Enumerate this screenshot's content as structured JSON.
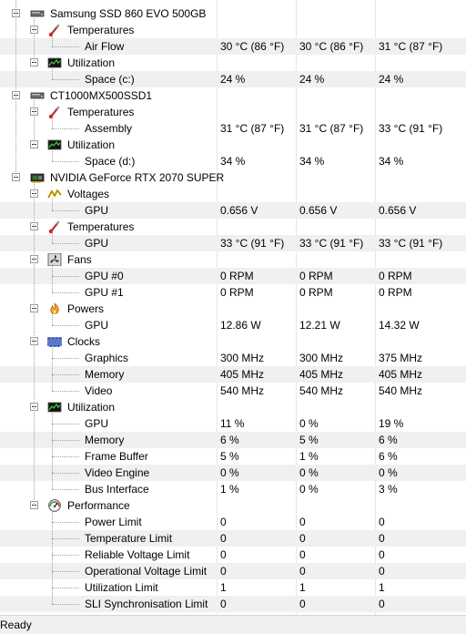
{
  "tree": [
    {
      "level": 0,
      "kind": "device",
      "icon": "hdd-icon",
      "label": "Samsung SSD 860 EVO 500GB"
    },
    {
      "level": 1,
      "kind": "group",
      "icon": "thermometer-icon",
      "label": "Temperatures"
    },
    {
      "level": 2,
      "kind": "sensor",
      "label": "Air Flow",
      "values": [
        "30 °C  (86 °F)",
        "30 °C  (86 °F)",
        "31 °C  (87 °F)"
      ]
    },
    {
      "level": 1,
      "kind": "group",
      "icon": "utilization-icon",
      "label": "Utilization"
    },
    {
      "level": 2,
      "kind": "sensor",
      "label": "Space (c:)",
      "values": [
        "24 %",
        "24 %",
        "24 %"
      ]
    },
    {
      "level": 0,
      "kind": "device",
      "icon": "hdd-icon",
      "label": "CT1000MX500SSD1"
    },
    {
      "level": 1,
      "kind": "group",
      "icon": "thermometer-icon",
      "label": "Temperatures"
    },
    {
      "level": 2,
      "kind": "sensor",
      "label": "Assembly",
      "values": [
        "31 °C  (87 °F)",
        "31 °C  (87 °F)",
        "33 °C  (91 °F)"
      ]
    },
    {
      "level": 1,
      "kind": "group",
      "icon": "utilization-icon",
      "label": "Utilization"
    },
    {
      "level": 2,
      "kind": "sensor",
      "label": "Space (d:)",
      "values": [
        "34 %",
        "34 %",
        "34 %"
      ]
    },
    {
      "level": 0,
      "kind": "device",
      "icon": "gpu-icon",
      "label": "NVIDIA GeForce RTX 2070 SUPER"
    },
    {
      "level": 1,
      "kind": "group",
      "icon": "voltage-icon",
      "label": "Voltages"
    },
    {
      "level": 2,
      "kind": "sensor",
      "label": "GPU",
      "values": [
        "0.656 V",
        "0.656 V",
        "0.656 V"
      ]
    },
    {
      "level": 1,
      "kind": "group",
      "icon": "thermometer-icon",
      "label": "Temperatures"
    },
    {
      "level": 2,
      "kind": "sensor",
      "label": "GPU",
      "values": [
        "33 °C  (91 °F)",
        "33 °C  (91 °F)",
        "33 °C  (91 °F)"
      ]
    },
    {
      "level": 1,
      "kind": "group",
      "icon": "fan-icon",
      "label": "Fans"
    },
    {
      "level": 2,
      "kind": "sensor",
      "label": "GPU #0",
      "values": [
        "0 RPM",
        "0 RPM",
        "0 RPM"
      ]
    },
    {
      "level": 2,
      "kind": "sensor",
      "label": "GPU #1",
      "values": [
        "0 RPM",
        "0 RPM",
        "0 RPM"
      ]
    },
    {
      "level": 1,
      "kind": "group",
      "icon": "power-icon",
      "label": "Powers"
    },
    {
      "level": 2,
      "kind": "sensor",
      "label": "GPU",
      "values": [
        "12.86 W",
        "12.21 W",
        "14.32 W"
      ]
    },
    {
      "level": 1,
      "kind": "group",
      "icon": "clock-icon",
      "label": "Clocks"
    },
    {
      "level": 2,
      "kind": "sensor",
      "label": "Graphics",
      "values": [
        "300 MHz",
        "300 MHz",
        "375 MHz"
      ]
    },
    {
      "level": 2,
      "kind": "sensor",
      "label": "Memory",
      "values": [
        "405 MHz",
        "405 MHz",
        "405 MHz"
      ]
    },
    {
      "level": 2,
      "kind": "sensor",
      "label": "Video",
      "values": [
        "540 MHz",
        "540 MHz",
        "540 MHz"
      ]
    },
    {
      "level": 1,
      "kind": "group",
      "icon": "utilization-icon",
      "label": "Utilization"
    },
    {
      "level": 2,
      "kind": "sensor",
      "label": "GPU",
      "values": [
        "11 %",
        "0 %",
        "19 %"
      ]
    },
    {
      "level": 2,
      "kind": "sensor",
      "label": "Memory",
      "values": [
        "6 %",
        "5 %",
        "6 %"
      ]
    },
    {
      "level": 2,
      "kind": "sensor",
      "label": "Frame Buffer",
      "values": [
        "5 %",
        "1 %",
        "6 %"
      ]
    },
    {
      "level": 2,
      "kind": "sensor",
      "label": "Video Engine",
      "values": [
        "0 %",
        "0 %",
        "0 %"
      ]
    },
    {
      "level": 2,
      "kind": "sensor",
      "label": "Bus Interface",
      "values": [
        "1 %",
        "0 %",
        "3 %"
      ]
    },
    {
      "level": 1,
      "kind": "group",
      "icon": "performance-icon",
      "label": "Performance"
    },
    {
      "level": 2,
      "kind": "sensor",
      "label": "Power Limit",
      "values": [
        "0",
        "0",
        "0"
      ]
    },
    {
      "level": 2,
      "kind": "sensor",
      "label": "Temperature Limit",
      "values": [
        "0",
        "0",
        "0"
      ]
    },
    {
      "level": 2,
      "kind": "sensor",
      "label": "Reliable Voltage Limit",
      "values": [
        "0",
        "0",
        "0"
      ]
    },
    {
      "level": 2,
      "kind": "sensor",
      "label": "Operational Voltage Limit",
      "values": [
        "0",
        "0",
        "0"
      ]
    },
    {
      "level": 2,
      "kind": "sensor",
      "label": "Utilization Limit",
      "values": [
        "1",
        "1",
        "1"
      ]
    },
    {
      "level": 2,
      "kind": "sensor",
      "label": "SLI Synchronisation Limit",
      "values": [
        "0",
        "0",
        "0"
      ]
    }
  ],
  "statusbar": {
    "text": "Ready"
  },
  "colors": {
    "thermometer": "#d62020",
    "voltage": "#e6b800",
    "power": "#f0a020",
    "clock": "#1a3fb0",
    "utilization": "#2a8a2a"
  }
}
